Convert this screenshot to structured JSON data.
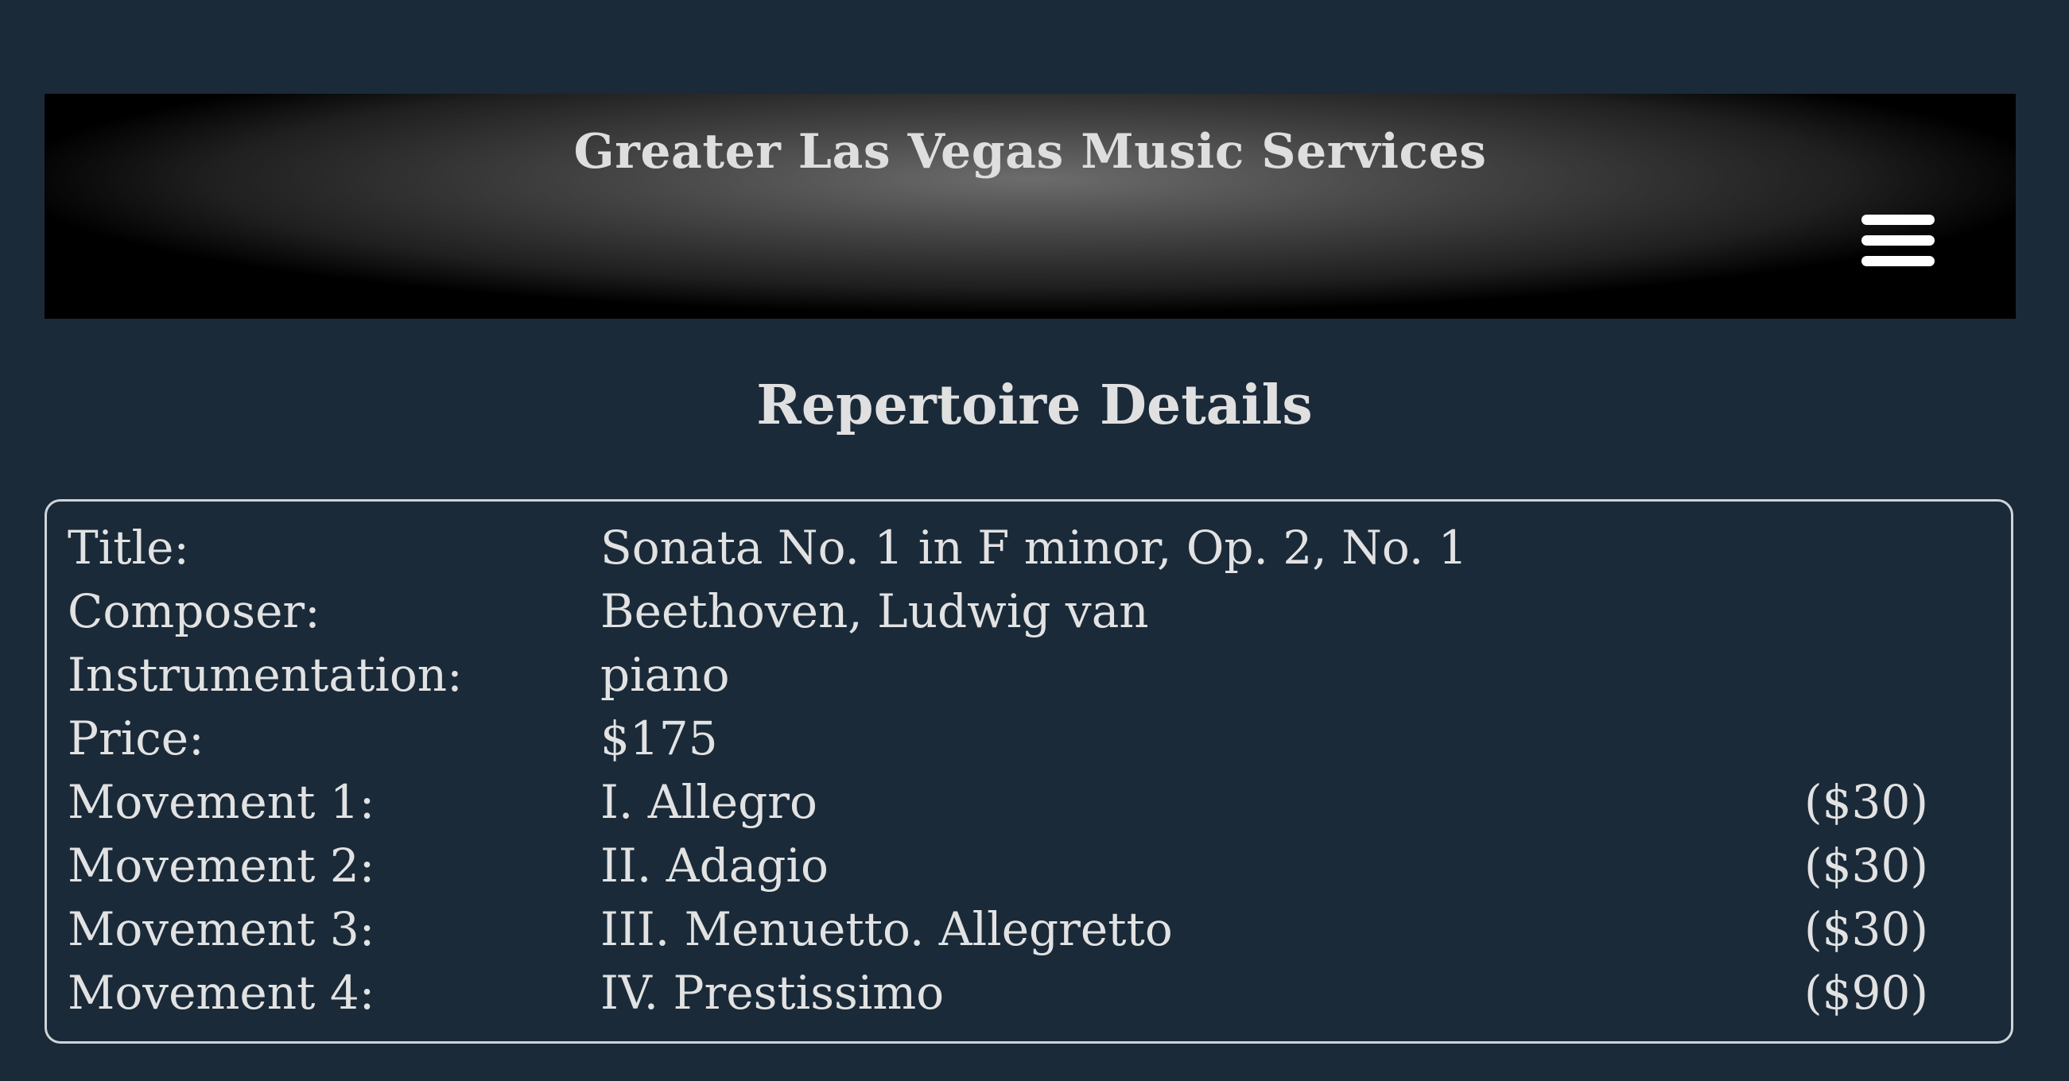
{
  "header": {
    "site_title": "Greater Las Vegas Music Services",
    "menu_icon": "hamburger-menu-icon"
  },
  "page_title": "Repertoire Details",
  "details": {
    "title": {
      "label": "Title:",
      "value": "Sonata No. 1 in F minor, Op. 2, No. 1"
    },
    "composer": {
      "label": "Composer:",
      "value": "Beethoven, Ludwig van"
    },
    "instrumentation": {
      "label": "Instrumentation:",
      "value": "piano"
    },
    "price": {
      "label": "Price:",
      "value": "$175"
    },
    "movements": [
      {
        "label": "Movement 1:",
        "name": "I. Allegro",
        "price": "($30)"
      },
      {
        "label": "Movement 2:",
        "name": "II. Adagio",
        "price": "($30)"
      },
      {
        "label": "Movement 3:",
        "name": "III. Menuetto. Allegretto",
        "price": "($30)"
      },
      {
        "label": "Movement 4:",
        "name": "IV. Prestissimo",
        "price": "($90)"
      }
    ]
  },
  "colors": {
    "background": "#1a2a39",
    "text": "#e2e2e2",
    "border": "#cfd4d8",
    "menu_icon": "#ffffff"
  }
}
